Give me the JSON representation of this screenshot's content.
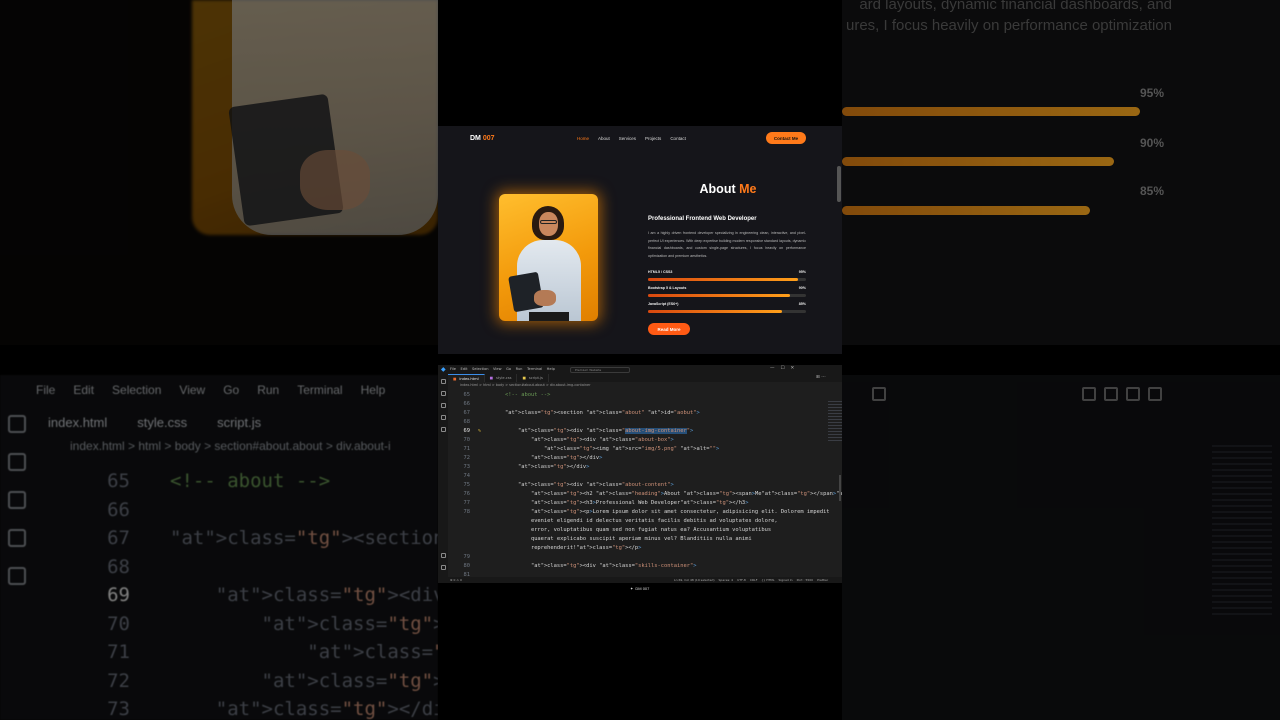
{
  "site": {
    "logo": {
      "text": "DM",
      "accent": "007"
    },
    "nav": [
      "Home",
      "About",
      "Services",
      "Projects",
      "Contact"
    ],
    "nav_active_index": 0,
    "contact_button": "Contact Me",
    "about": {
      "title_plain": "About",
      "title_accent": "Me",
      "subheading": "Professional Frontend Web Developer",
      "paragraph": "I am a highly driven frontend developer specializing in engineering clean, interactive, and pixel-perfect UI experiences. With deep expertise building modern responsive standard layouts, dynamic financial dashboards, and custom single-page structures, I focus heavily on performance optimization and premium aesthetics.",
      "skills": [
        {
          "label": "HTML5 / CSS3",
          "percent": 95
        },
        {
          "label": "Bootstrap 5 & Layouts",
          "percent": 90
        },
        {
          "label": "JavaScript (ES6+)",
          "percent": 85
        }
      ],
      "read_more": "Read More"
    }
  },
  "editor": {
    "menu": [
      "File",
      "Edit",
      "Selection",
      "View",
      "Go",
      "Run",
      "Terminal",
      "Help"
    ],
    "search_placeholder": "Premium Website",
    "tabs": [
      {
        "name": "index.html",
        "kind": "html",
        "active": true
      },
      {
        "name": "style.css",
        "kind": "css",
        "active": false
      },
      {
        "name": "script.js",
        "kind": "js",
        "active": false
      }
    ],
    "breadcrumb": "index.html > html > body > section#about.about > div.about-img-container",
    "current_line": 69,
    "lines": [
      {
        "n": "65",
        "code": "    <!-- about -->"
      },
      {
        "n": "66",
        "code": ""
      },
      {
        "n": "67",
        "code": "    <section class=\"about\" id=\"aobut\">"
      },
      {
        "n": "68",
        "code": ""
      },
      {
        "n": "69",
        "code": "        <div class=\"about-img-container\">"
      },
      {
        "n": "70",
        "code": "            <div class=\"about-box\">"
      },
      {
        "n": "71",
        "code": "                <img src=\"img/5.png\" alt=\"\">"
      },
      {
        "n": "72",
        "code": "            </div>"
      },
      {
        "n": "73",
        "code": "        </div>"
      },
      {
        "n": "74",
        "code": ""
      },
      {
        "n": "75",
        "code": "        <div class=\"about-content\">"
      },
      {
        "n": "76",
        "code": "            <h2 class=\"heading\">About <span>Me</span></h2>"
      },
      {
        "n": "77",
        "code": "            <h3>Professional Web Developer</h3>"
      },
      {
        "n": "78",
        "code": "            <p>Lorem ipsum dolor sit amet consectetur, adipisicing elit. Dolorem impedit"
      },
      {
        "n": "",
        "code": "            eveniet eligendi id delectus veritatis facilis debitis ad voluptates dolore,"
      },
      {
        "n": "",
        "code": "            error, voluptatibus quam sed non fugiat natus ea? Accusantium voluptatibus"
      },
      {
        "n": "",
        "code": "            quaerat explicabo suscipit aperiam minus vel? Blanditiis nulla animi"
      },
      {
        "n": "",
        "code": "            reprehenderit!</p>"
      },
      {
        "n": "79",
        "code": ""
      },
      {
        "n": "80",
        "code": "            <div class=\"skills-container\">"
      },
      {
        "n": "81",
        "code": ""
      }
    ],
    "status_left": "⊗ 0 ⚠ 0",
    "status_right": [
      "Ln 69, Col 48 (19 selected)",
      "Spaces: 4",
      "UTF-8",
      "CRLF",
      "{} HTML",
      "Signed In",
      "Port : 5500",
      "Prettier"
    ]
  },
  "footer_watermark": "DM 007",
  "background_left": {
    "menu": [
      "File",
      "Edit",
      "Selection",
      "View",
      "Go",
      "Run",
      "Terminal",
      "Help"
    ],
    "tabs": [
      "index.html",
      "style.css",
      "script.js"
    ],
    "breadcrumb": "index.html > html > body > section#about.about > div.about-i",
    "lines": [
      {
        "n": "65",
        "code": "<!-- about -->"
      },
      {
        "n": "66",
        "code": ""
      },
      {
        "n": "67",
        "code": "<section class=\"about\""
      },
      {
        "n": "68",
        "code": ""
      },
      {
        "n": "69",
        "code": "    <div class=\"about-i"
      },
      {
        "n": "70",
        "code": "        <div class=\"abo"
      },
      {
        "n": "71",
        "code": "            <img src=\"i"
      },
      {
        "n": "72",
        "code": "        </div>"
      },
      {
        "n": "73",
        "code": "    </div>"
      }
    ]
  },
  "background_right": {
    "paragraph": "ard layouts, dynamic financial dashboards, and ures, I focus heavily on performance optimization",
    "percents": [
      "95%",
      "90%",
      "85%"
    ]
  },
  "colors": {
    "accent": "#ff7a1a",
    "button": "#ff5a14",
    "editor_bg": "#1e1e1e",
    "site_bg": "#15151a"
  }
}
